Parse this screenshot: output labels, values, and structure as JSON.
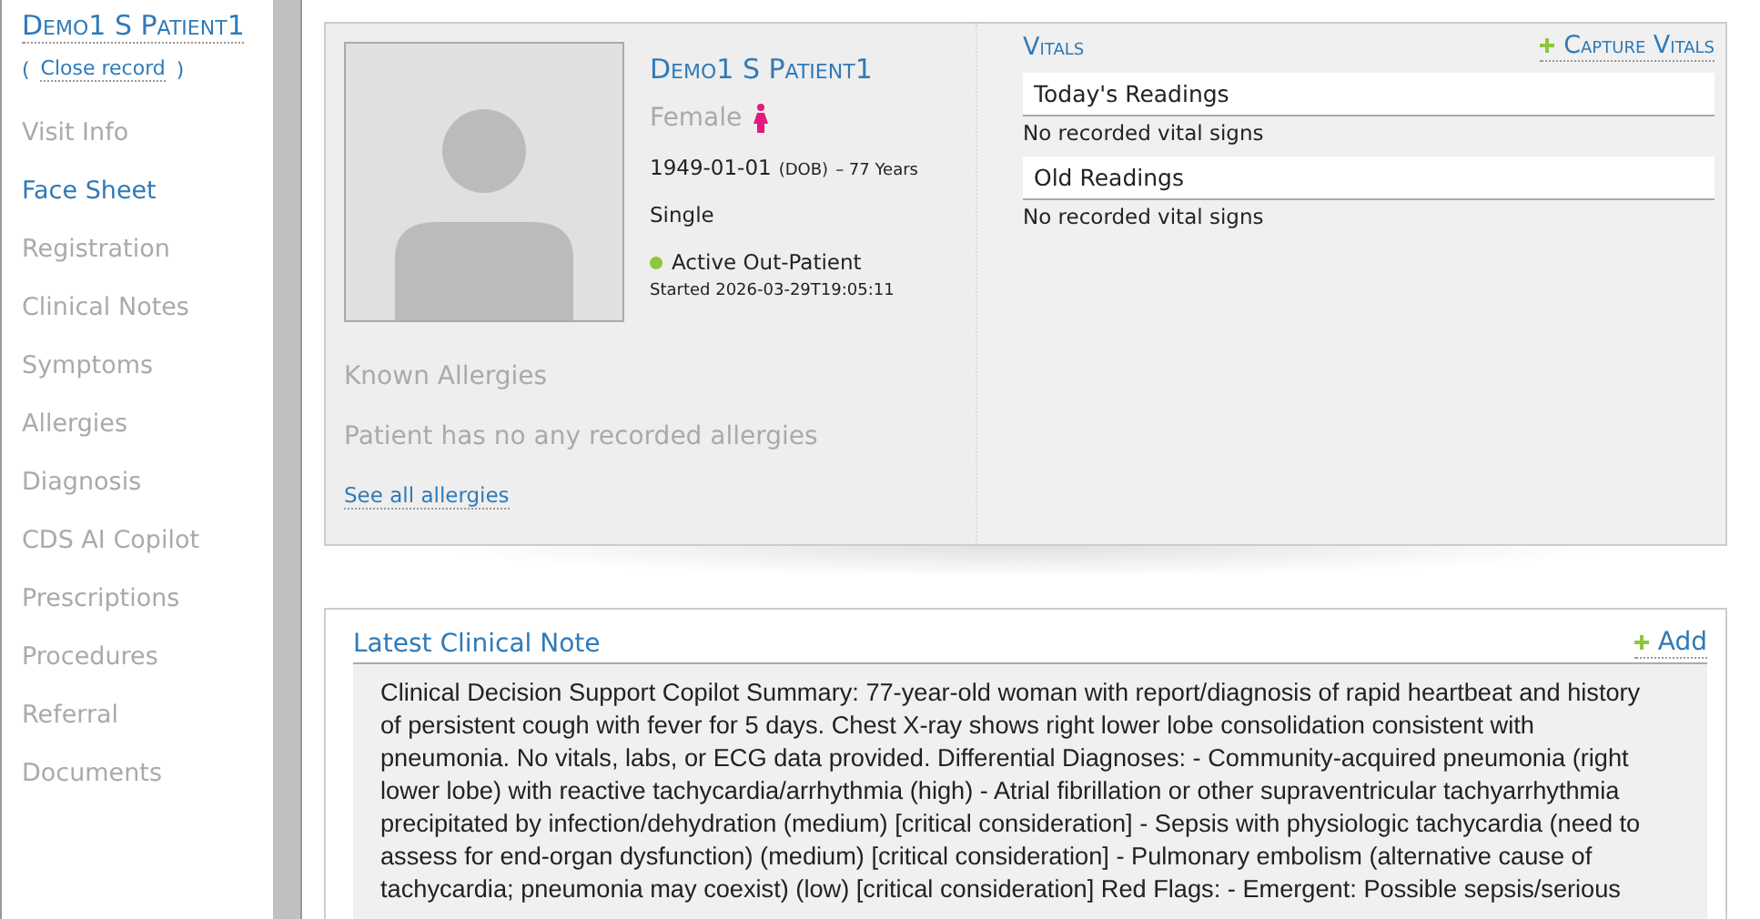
{
  "sidebar": {
    "patient_name": "Demo1 S Patient1",
    "close_open": "(",
    "close_link": "Close record",
    "close_close": ")",
    "items": [
      {
        "label": "Visit Info",
        "selected": false
      },
      {
        "label": "Face Sheet",
        "selected": true
      },
      {
        "label": "Registration",
        "selected": false
      },
      {
        "label": "Clinical Notes",
        "selected": false
      },
      {
        "label": "Symptoms",
        "selected": false
      },
      {
        "label": "Allergies",
        "selected": false
      },
      {
        "label": "Diagnosis",
        "selected": false
      },
      {
        "label": "CDS AI Copilot",
        "selected": false
      },
      {
        "label": "Prescriptions",
        "selected": false
      },
      {
        "label": "Procedures",
        "selected": false
      },
      {
        "label": "Referral",
        "selected": false
      },
      {
        "label": "Documents",
        "selected": false
      }
    ]
  },
  "patient": {
    "name": "Demo1 S Patient1",
    "gender": "Female",
    "dob": "1949-01-01",
    "dob_label": "(DOB)",
    "age": "– 77 Years",
    "marital_status": "Single",
    "status": {
      "label": "Active Out-Patient",
      "color": "#8dc63f"
    },
    "started": "Started 2026-03-29T19:05:11",
    "allergies_title": "Known Allergies",
    "allergies_text": "Patient has no any recorded allergies",
    "allergies_link": "See all allergies"
  },
  "vitals": {
    "title": "Vitals",
    "capture": "Capture Vitals",
    "sections": [
      {
        "title": "Today's Readings",
        "text": "No recorded vital signs"
      },
      {
        "title": "Old Readings",
        "text": "No recorded vital signs"
      }
    ]
  },
  "clinical_note": {
    "title": "Latest Clinical Note",
    "add": "Add",
    "text": "Clinical Decision Support Copilot Summary: 77-year-old woman with report/diagnosis of rapid heartbeat and history of persistent cough with fever for 5 days. Chest X-ray shows right lower lobe consolidation consistent with pneumonia. No vitals, labs, or ECG data provided. Differential Diagnoses: - Community-acquired pneumonia (right lower lobe) with reactive tachycardia/arrhythmia (high) - Atrial fibrillation or other supraventricular tachyarrhythmia precipitated by infection/dehydration (medium) [critical consideration] - Sepsis with physiologic tachycardia (need to assess for end-organ dysfunction) (medium) [critical consideration] - Pulmonary embolism (alternative cause of tachycardia; pneumonia may coexist) (low) [critical consideration] Red Flags: - Emergent: Possible sepsis/serious"
  }
}
